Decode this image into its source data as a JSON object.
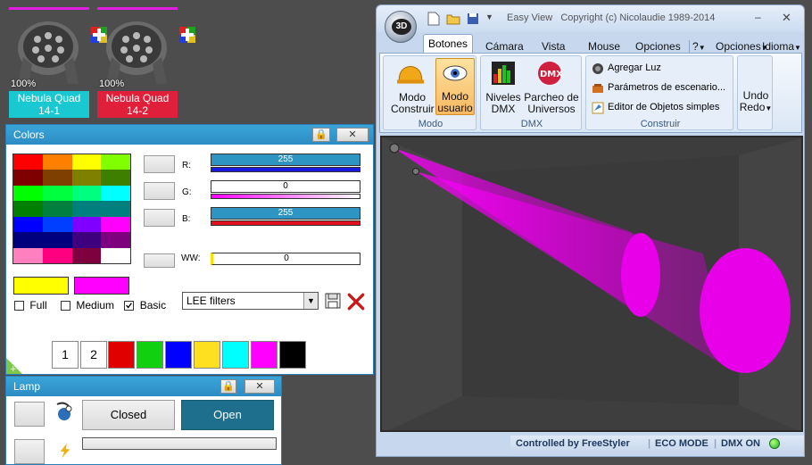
{
  "fixtures": [
    {
      "percent": "100%",
      "name_line1": "Nebula Quad",
      "name_line2": "14-1",
      "label_color": "#19c8d0"
    },
    {
      "percent": "100%",
      "name_line1": "Nebula Quad",
      "name_line2": "14-2",
      "label_color": "#e0203a"
    }
  ],
  "colors_panel": {
    "title": "Colors",
    "palette_grid": [
      [
        "#ff0000",
        "#ff7f00",
        "#ffff00",
        "#7fff00"
      ],
      [
        "#7f0000",
        "#7f3f00",
        "#7f7f00",
        "#3f7f00"
      ],
      [
        "#00ff00",
        "#00ff3f",
        "#00ff7f",
        "#00ffff"
      ],
      [
        "#007f00",
        "#007f3f",
        "#007f7f",
        "#007f7f"
      ],
      [
        "#0000ff",
        "#003fff",
        "#7f00ff",
        "#ff00ff"
      ],
      [
        "#00007f",
        "#00007f",
        "#3f007f",
        "#7f007f"
      ],
      [
        "#ff7fbf",
        "#ff0080",
        "#7f003f",
        "#ffffff"
      ]
    ],
    "sliders": [
      {
        "label": "R:",
        "value": "255",
        "bar_color": "#1a1ae0"
      },
      {
        "label": "G:",
        "value": "0",
        "bar_color": "#ff00ff"
      },
      {
        "label": "B:",
        "value": "255",
        "bar_color": "#e01020"
      },
      {
        "label": "WW:",
        "value": "0"
      }
    ],
    "swatch_a": "#ffff00",
    "swatch_b": "#ff00ff",
    "filter_options": {
      "full": "Full",
      "medium": "Medium",
      "basic": "Basic"
    },
    "filter_select": "LEE filters",
    "preset_numbers": [
      "1",
      "2"
    ],
    "preset_colors": [
      "#e00000",
      "#10d010",
      "#0000ff",
      "#ffe020",
      "#00ffff",
      "#ff00ff",
      "#000000"
    ]
  },
  "lamp_panel": {
    "title": "Lamp",
    "closed_label": "Closed",
    "open_label": "Open"
  },
  "easy_view": {
    "title": "Easy View",
    "copyright": "Copyright (c) Nicolaudie 1989-2014",
    "logo": "3D",
    "tabs": [
      "Botones e",
      "Cámara",
      "Vista",
      "Mouse",
      "Opciones"
    ],
    "right_menus": [
      "?",
      "Opciones",
      "Idioma"
    ],
    "modo": {
      "construir": "Modo\nConstruir",
      "usuario": "Modo\nusuario",
      "group": "Modo"
    },
    "dmx": {
      "niveles": "Niveles\nDMX",
      "parcheo": "Parcheo de\nUniversos",
      "group": "DMX",
      "dmx_icon_text": "DMX"
    },
    "construir": {
      "agregar": "Agregar Luz",
      "parametros": "Parámetros de escenario...",
      "editor": "Editor de Objetos simples",
      "group": "Construir"
    },
    "undo": "Undo\nRedo",
    "status": {
      "controlled": "Controlled by FreeStyler",
      "eco": "ECO MODE",
      "dmx_on": "DMX ON"
    }
  }
}
